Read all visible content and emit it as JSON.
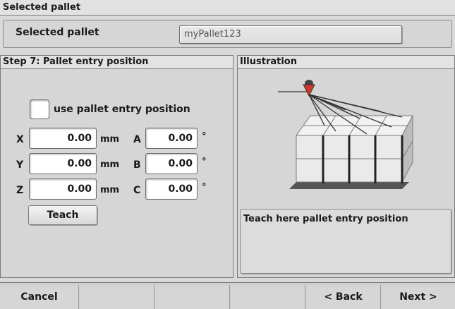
{
  "header": {
    "title": "Selected pallet"
  },
  "selected": {
    "label": "Selected pallet",
    "value": "myPallet123"
  },
  "step_panel": {
    "title": "Step 7: Pallet entry position",
    "checkbox_label": "use pallet entry position",
    "fields": [
      {
        "axis": "X",
        "value": "0.00",
        "unit": "mm"
      },
      {
        "axis": "Y",
        "value": "0.00",
        "unit": "mm"
      },
      {
        "axis": "Z",
        "value": "0.00",
        "unit": "mm"
      },
      {
        "axis": "A",
        "value": "0.00",
        "unit": "°"
      },
      {
        "axis": "B",
        "value": "0.00",
        "unit": "°"
      },
      {
        "axis": "C",
        "value": "0.00",
        "unit": "°"
      }
    ],
    "teach_label": "Teach"
  },
  "illustration": {
    "title": "Illustration",
    "hint": "Teach here pallet entry position"
  },
  "footer": {
    "cancel": "Cancel",
    "back": "< Back",
    "next": "Next >"
  }
}
